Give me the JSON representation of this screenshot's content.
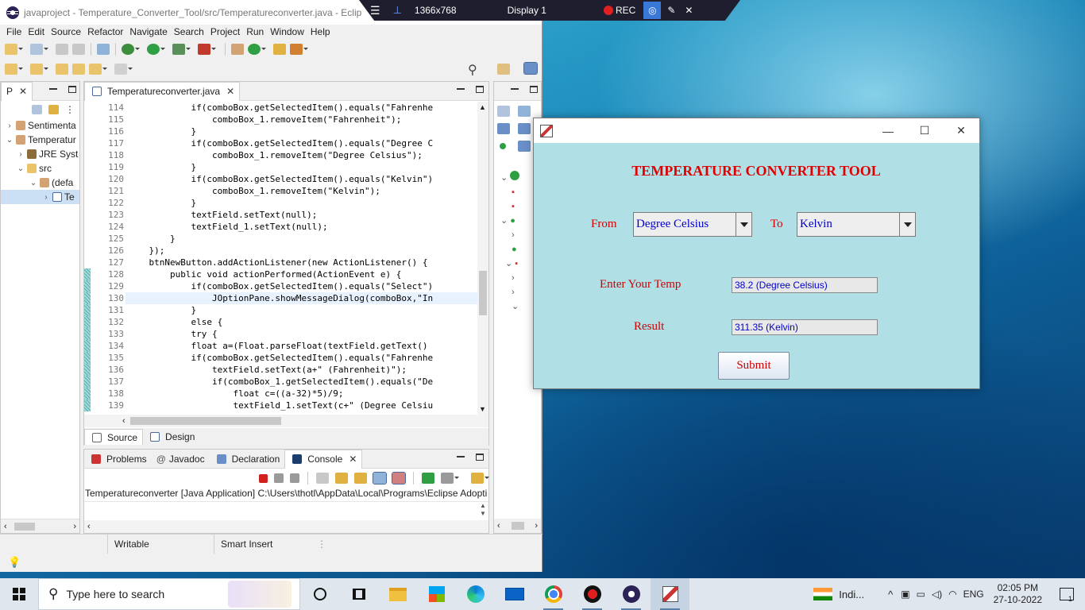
{
  "eclipse": {
    "title": "javaproject - Temperature_Converter_Tool/src/Temperatureconverter.java - Eclip",
    "menu": [
      "File",
      "Edit",
      "Source",
      "Refactor",
      "Navigate",
      "Search",
      "Project",
      "Run",
      "Window",
      "Help"
    ],
    "explorer_tab": "P",
    "tree": [
      "Sentimenta",
      "Temperatur",
      "JRE Syst",
      "src",
      "(defa",
      "Te"
    ],
    "editor_tab": "Temperatureconverter.java",
    "code_lines": [
      {
        "n": "114",
        "t": "            if(comboBox.getSelectedItem().equals(\"Fahrenhe"
      },
      {
        "n": "115",
        "t": "                comboBox_1.removeItem(\"Fahrenheit\");"
      },
      {
        "n": "116",
        "t": "            }"
      },
      {
        "n": "117",
        "t": "            if(comboBox.getSelectedItem().equals(\"Degree C"
      },
      {
        "n": "118",
        "t": "                comboBox_1.removeItem(\"Degree Celsius\");"
      },
      {
        "n": "119",
        "t": "            }"
      },
      {
        "n": "120",
        "t": "            if(comboBox.getSelectedItem().equals(\"Kelvin\")"
      },
      {
        "n": "121",
        "t": "                comboBox_1.removeItem(\"Kelvin\");"
      },
      {
        "n": "122",
        "t": "            }"
      },
      {
        "n": "123",
        "t": "            textField.setText(null);"
      },
      {
        "n": "124",
        "t": "            textField_1.setText(null);"
      },
      {
        "n": "125",
        "t": "        }"
      },
      {
        "n": "126",
        "t": "    });"
      },
      {
        "n": "127",
        "t": "    btnNewButton.addActionListener(new ActionListener() {"
      },
      {
        "n": "128",
        "t": "        public void actionPerformed(ActionEvent e) {"
      },
      {
        "n": "129",
        "t": "            if(comboBox.getSelectedItem().equals(\"Select\")"
      },
      {
        "n": "130",
        "t": "                JOptionPane.showMessageDialog(comboBox,\"In"
      },
      {
        "n": "131",
        "t": "            }"
      },
      {
        "n": "132",
        "t": "            else {"
      },
      {
        "n": "133",
        "t": "            try {"
      },
      {
        "n": "134",
        "t": "            float a=(Float.parseFloat(textField.getText()"
      },
      {
        "n": "135",
        "t": "            if(comboBox.getSelectedItem().equals(\"Fahrenhe"
      },
      {
        "n": "136",
        "t": "                textField.setText(a+\" (Fahrenheit)\");"
      },
      {
        "n": "137",
        "t": "                if(comboBox_1.getSelectedItem().equals(\"De"
      },
      {
        "n": "138",
        "t": "                    float c=((a-32)*5)/9;"
      },
      {
        "n": "139",
        "t": "                    textField_1.setText(c+\" (Degree Celsiu"
      }
    ],
    "source_tab": "Source",
    "design_tab": "Design",
    "bottom_tabs": [
      "Problems",
      "Javadoc",
      "Declaration",
      "Console"
    ],
    "console_line": "Temperatureconverter [Java Application] C:\\Users\\thotl\\AppData\\Local\\Programs\\Eclipse Adopti",
    "status_writable": "Writable",
    "status_insert": "Smart Insert"
  },
  "recbar": {
    "resolution": "1366x768",
    "display": "Display 1",
    "rec": "REC"
  },
  "app": {
    "title": "TEMPERATURE CONVERTER TOOL",
    "from_label": "From",
    "from_value": "Degree Celsius",
    "to_label": "To",
    "to_value": "Kelvin",
    "temp_label": "Enter Your Temp",
    "temp_value": "38.2 (Degree Celsius)",
    "result_label": "Result",
    "result_value": "311.35 (Kelvin)",
    "submit_label": "Submit"
  },
  "taskbar": {
    "search_placeholder": "Type here to search",
    "lang_short": "Indi...",
    "lang": "ENG",
    "time": "02:05 PM",
    "date": "27-10-2022",
    "notifications": "1"
  }
}
